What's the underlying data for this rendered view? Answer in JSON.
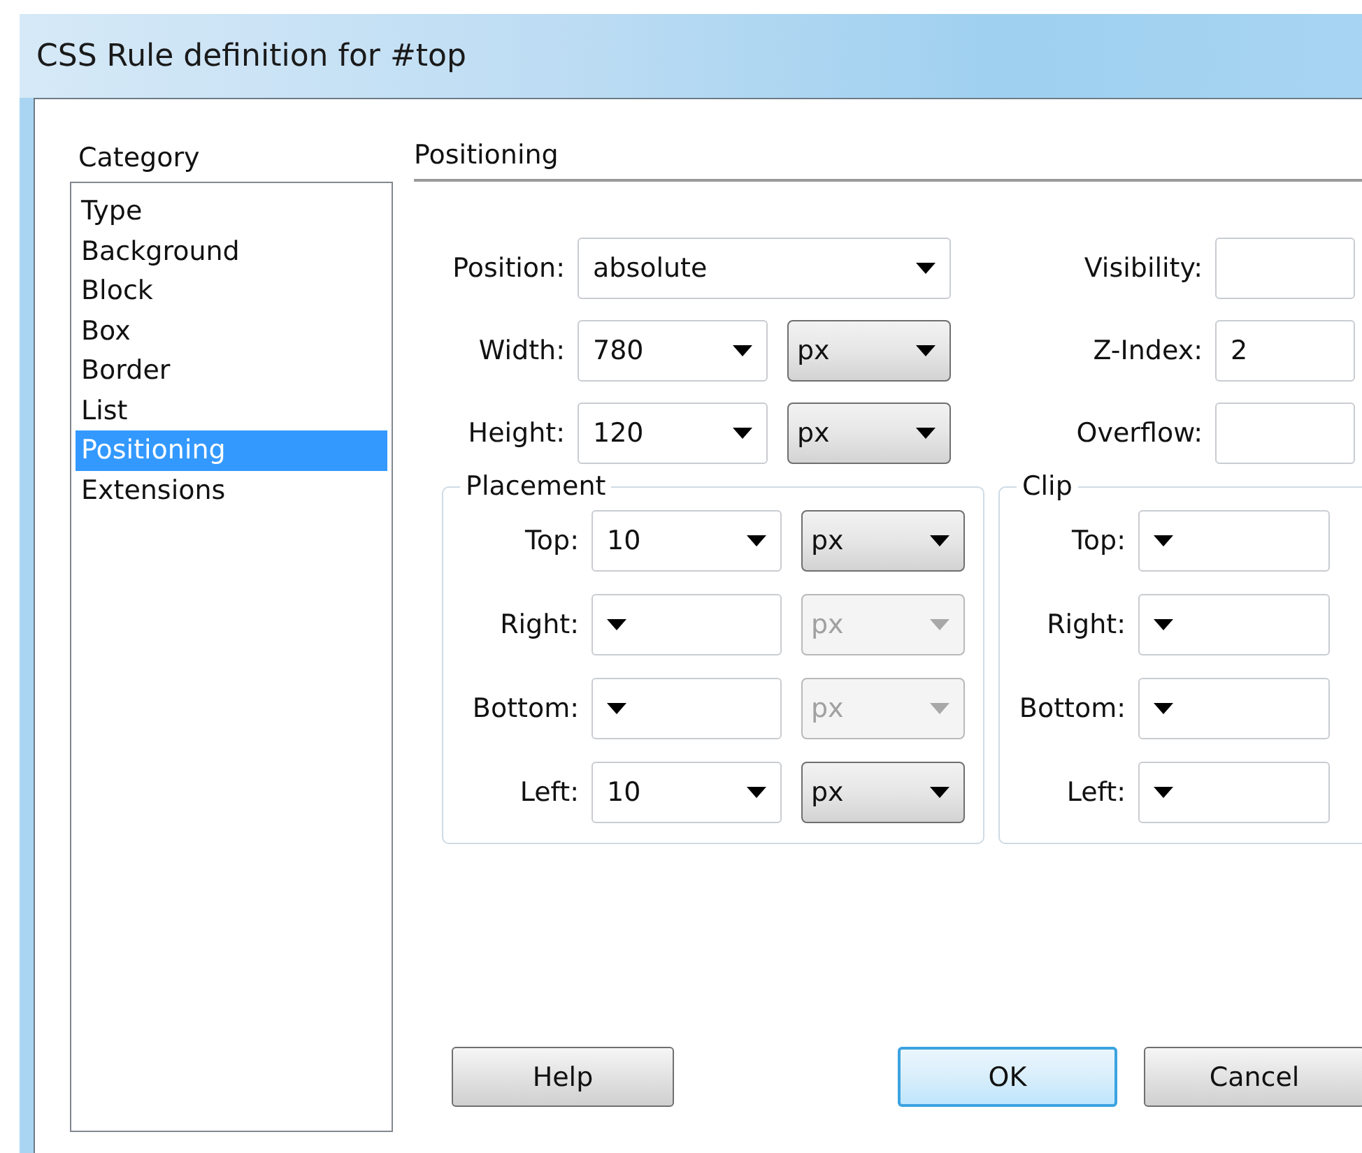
{
  "window": {
    "title": "CSS Rule definition for #top"
  },
  "category": {
    "label": "Category",
    "items": [
      {
        "label": "Type",
        "selected": false
      },
      {
        "label": "Background",
        "selected": false
      },
      {
        "label": "Block",
        "selected": false
      },
      {
        "label": "Box",
        "selected": false
      },
      {
        "label": "Border",
        "selected": false
      },
      {
        "label": "List",
        "selected": false
      },
      {
        "label": "Positioning",
        "selected": true
      },
      {
        "label": "Extensions",
        "selected": false
      }
    ]
  },
  "panel": {
    "title": "Positioning",
    "main_fields": [
      {
        "label": "Position:",
        "value": "absolute",
        "kind": "select"
      },
      {
        "label": "Width:",
        "value": "780",
        "kind": "combo",
        "unit": "px",
        "unit_disabled": false
      },
      {
        "label": "Height:",
        "value": "120",
        "kind": "combo",
        "unit": "px",
        "unit_disabled": false
      }
    ],
    "side_fields": [
      {
        "label": "Visibility:"
      },
      {
        "label": "Z-Index:",
        "value": "2"
      },
      {
        "label": "Overflow:"
      }
    ],
    "placement": {
      "legend": "Placement",
      "rows": [
        {
          "label": "Top:",
          "value": "10",
          "unit": "px",
          "unit_disabled": false
        },
        {
          "label": "Right:",
          "unit": "px",
          "unit_disabled": true
        },
        {
          "label": "Bottom:",
          "unit": "px",
          "unit_disabled": true
        },
        {
          "label": "Left:",
          "value": "10",
          "unit": "px",
          "unit_disabled": false
        }
      ]
    },
    "clip": {
      "legend": "Clip",
      "rows": [
        {
          "label": "Top:"
        },
        {
          "label": "Right:"
        },
        {
          "label": "Bottom:"
        },
        {
          "label": "Left:"
        }
      ]
    }
  },
  "buttons": [
    {
      "label": "Help",
      "default": false
    },
    {
      "label": "OK",
      "default": true
    },
    {
      "label": "Cancel",
      "default": false
    }
  ]
}
